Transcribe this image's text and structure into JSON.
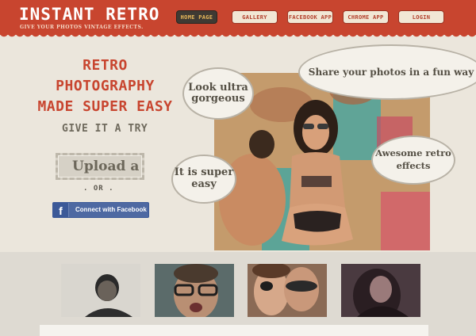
{
  "header": {
    "logo": "INSTANT RETRO",
    "tagline": "GIVE YOUR PHOTOS VINTAGE EFFECTS.",
    "nav": [
      {
        "label": "HOME PAGE",
        "active": true
      },
      {
        "label": "GALLERY",
        "active": false
      },
      {
        "label": "FACEBOOK APP",
        "active": false
      },
      {
        "label": "CHROME APP",
        "active": false
      },
      {
        "label": "LOGIN",
        "active": false
      }
    ]
  },
  "hero": {
    "title_line1": "RETRO PHOTOGRAPHY",
    "title_line2": "MADE SUPER EASY",
    "give_try": "GIVE IT A TRY",
    "upload_label": "Upload a",
    "or_text": ". OR .",
    "facebook_label": "Connect with Facebook",
    "facebook_icon": "f"
  },
  "clouds": {
    "share": "Share your photos in a fun way",
    "gorgeous": "Look ultra gorgeous",
    "easy": "It is super easy",
    "effects": "Awesome retro effects"
  },
  "colors": {
    "header": "#c8452f",
    "facebook": "#3b5998",
    "background": "#ebe6dc"
  }
}
